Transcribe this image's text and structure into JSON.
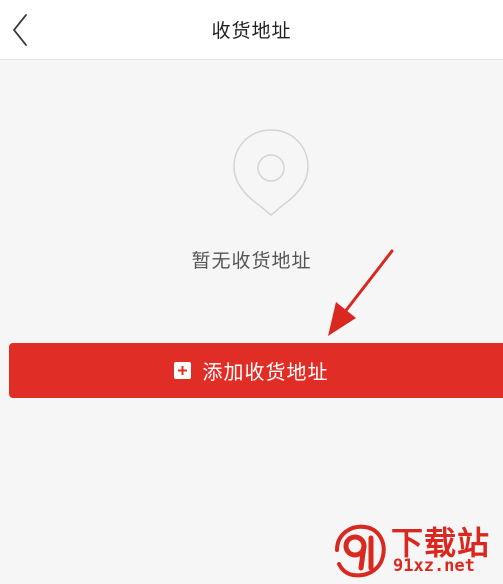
{
  "header": {
    "title": "收货地址",
    "back_icon": "chevron-left-icon"
  },
  "empty_state": {
    "icon": "location-pin-icon",
    "message": "暂无收货地址"
  },
  "add_button": {
    "label": "添加收货地址",
    "icon": "plus-square-icon"
  },
  "watermark": {
    "brand": "下载站",
    "url": "91xz.net",
    "logo_text": "91"
  },
  "colors": {
    "accent_red": "#e02e27",
    "annotation_red": "#d9281f",
    "background": "#f6f6f6"
  }
}
